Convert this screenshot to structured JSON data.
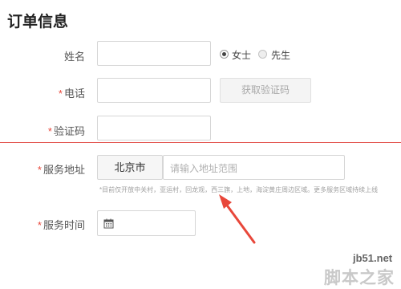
{
  "page": {
    "title": "订单信息"
  },
  "form": {
    "required_mark": "*",
    "name": {
      "label": "姓名",
      "value": "",
      "gender_options": [
        {
          "label": "女士",
          "selected": true
        },
        {
          "label": "先生",
          "selected": false
        }
      ]
    },
    "phone": {
      "label": "电话",
      "value": "",
      "get_code_button": "获取验证码"
    },
    "code": {
      "label": "验证码",
      "value": ""
    },
    "address": {
      "label": "服务地址",
      "city": "北京市",
      "placeholder": "请输入地址范围",
      "note": "*目前仅开放中关村，亚运村，回龙观，西三旗，上地，海淀黄庄周边区域。更多服务区域持续上线"
    },
    "time": {
      "label": "服务时间",
      "icon": "calendar-icon",
      "value": ""
    }
  },
  "annotation": {
    "line_color": "#e45a55",
    "arrow_color": "#e8473a"
  },
  "watermark": {
    "site": "jb51.net",
    "brand": "脚本之家"
  }
}
